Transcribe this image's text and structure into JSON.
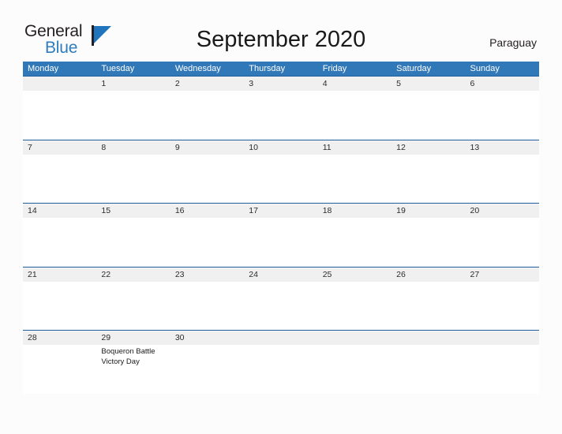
{
  "brand": {
    "line1": "General",
    "line2": "Blue",
    "flag_icon": "blue-flag-triangle-icon",
    "accent_color": "#1f74bd",
    "text_color": "#231f20"
  },
  "header": {
    "title": "September 2020",
    "region": "Paraguay"
  },
  "calendar": {
    "header_bg": "#3178b8",
    "row_divider_color": "#1f5f9e",
    "date_band_color": "#f0f0f0",
    "weekdays": [
      "Monday",
      "Tuesday",
      "Wednesday",
      "Thursday",
      "Friday",
      "Saturday",
      "Sunday"
    ],
    "weeks": [
      [
        {
          "day": "",
          "events": []
        },
        {
          "day": "1",
          "events": []
        },
        {
          "day": "2",
          "events": []
        },
        {
          "day": "3",
          "events": []
        },
        {
          "day": "4",
          "events": []
        },
        {
          "day": "5",
          "events": []
        },
        {
          "day": "6",
          "events": []
        }
      ],
      [
        {
          "day": "7",
          "events": []
        },
        {
          "day": "8",
          "events": []
        },
        {
          "day": "9",
          "events": []
        },
        {
          "day": "10",
          "events": []
        },
        {
          "day": "11",
          "events": []
        },
        {
          "day": "12",
          "events": []
        },
        {
          "day": "13",
          "events": []
        }
      ],
      [
        {
          "day": "14",
          "events": []
        },
        {
          "day": "15",
          "events": []
        },
        {
          "day": "16",
          "events": []
        },
        {
          "day": "17",
          "events": []
        },
        {
          "day": "18",
          "events": []
        },
        {
          "day": "19",
          "events": []
        },
        {
          "day": "20",
          "events": []
        }
      ],
      [
        {
          "day": "21",
          "events": []
        },
        {
          "day": "22",
          "events": []
        },
        {
          "day": "23",
          "events": []
        },
        {
          "day": "24",
          "events": []
        },
        {
          "day": "25",
          "events": []
        },
        {
          "day": "26",
          "events": []
        },
        {
          "day": "27",
          "events": []
        }
      ],
      [
        {
          "day": "28",
          "events": []
        },
        {
          "day": "29",
          "events": [
            "Boqueron Battle Victory Day"
          ]
        },
        {
          "day": "30",
          "events": []
        },
        {
          "day": "",
          "events": []
        },
        {
          "day": "",
          "events": []
        },
        {
          "day": "",
          "events": []
        },
        {
          "day": "",
          "events": []
        }
      ]
    ]
  }
}
